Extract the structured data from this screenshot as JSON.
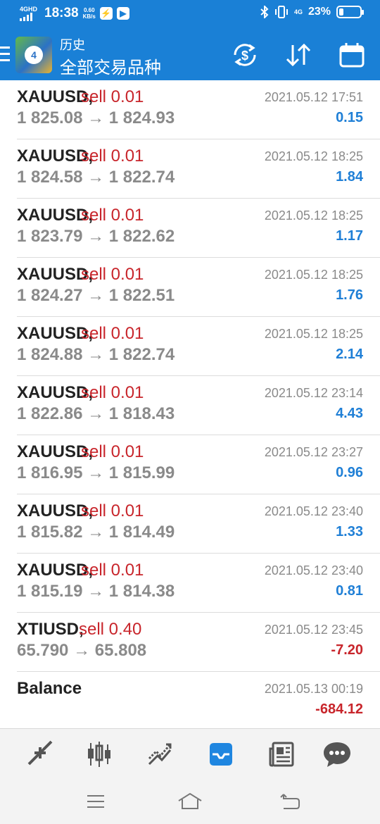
{
  "status_bar": {
    "network": "4GHD",
    "time": "18:38",
    "speed_value": "0.60",
    "speed_unit": "KB/s",
    "right_network": "4G",
    "battery_percent": "23%",
    "battery_level": 0.23,
    "icons": [
      "signal-icon",
      "flash-icon",
      "play-icon",
      "bluetooth-icon",
      "vibrate-icon",
      "battery-icon"
    ]
  },
  "toolbar": {
    "subtitle": "历史",
    "title": "全部交易品种",
    "icons": [
      "currency-exchange-icon",
      "sort-arrows-icon",
      "calendar-icon"
    ]
  },
  "trades": [
    {
      "symbol": "XAUUSD,",
      "side": "sell 0.01",
      "open": "1 825.08",
      "close": "1 824.93",
      "time": "2021.05.12 17:51",
      "profit": "0.15",
      "sign": "pos"
    },
    {
      "symbol": "XAUUSD,",
      "side": "sell 0.01",
      "open": "1 824.58",
      "close": "1 822.74",
      "time": "2021.05.12 18:25",
      "profit": "1.84",
      "sign": "pos"
    },
    {
      "symbol": "XAUUSD,",
      "side": "sell 0.01",
      "open": "1 823.79",
      "close": "1 822.62",
      "time": "2021.05.12 18:25",
      "profit": "1.17",
      "sign": "pos"
    },
    {
      "symbol": "XAUUSD,",
      "side": "sell 0.01",
      "open": "1 824.27",
      "close": "1 822.51",
      "time": "2021.05.12 18:25",
      "profit": "1.76",
      "sign": "pos"
    },
    {
      "symbol": "XAUUSD,",
      "side": "sell 0.01",
      "open": "1 824.88",
      "close": "1 822.74",
      "time": "2021.05.12 18:25",
      "profit": "2.14",
      "sign": "pos"
    },
    {
      "symbol": "XAUUSD,",
      "side": "sell 0.01",
      "open": "1 822.86",
      "close": "1 818.43",
      "time": "2021.05.12 23:14",
      "profit": "4.43",
      "sign": "pos"
    },
    {
      "symbol": "XAUUSD,",
      "side": "sell 0.01",
      "open": "1 816.95",
      "close": "1 815.99",
      "time": "2021.05.12 23:27",
      "profit": "0.96",
      "sign": "pos"
    },
    {
      "symbol": "XAUUSD,",
      "side": "sell 0.01",
      "open": "1 815.82",
      "close": "1 814.49",
      "time": "2021.05.12 23:40",
      "profit": "1.33",
      "sign": "pos"
    },
    {
      "symbol": "XAUUSD,",
      "side": "sell 0.01",
      "open": "1 815.19",
      "close": "1 814.38",
      "time": "2021.05.12 23:40",
      "profit": "0.81",
      "sign": "pos"
    },
    {
      "symbol": "XTIUSD,",
      "side": "sell 0.40",
      "open": "65.790",
      "close": "65.808",
      "time": "2021.05.12 23:45",
      "profit": "-7.20",
      "sign": "neg"
    }
  ],
  "balance": {
    "label": "Balance",
    "time": "2021.05.13 00:19",
    "value": "-684.12"
  },
  "arrow": "→",
  "bottom_nav": [
    {
      "name": "quotes",
      "icon": "quotes-arrows-icon",
      "active": false
    },
    {
      "name": "chart",
      "icon": "candlestick-icon",
      "active": false
    },
    {
      "name": "trade",
      "icon": "trend-icon",
      "active": false
    },
    {
      "name": "history",
      "icon": "inbox-icon",
      "active": true
    },
    {
      "name": "news",
      "icon": "newspaper-icon",
      "active": false
    },
    {
      "name": "messages",
      "icon": "chat-icon",
      "active": false
    }
  ],
  "colors": {
    "primary": "#1a80d6",
    "sell": "#c8252b",
    "profit_positive": "#1f7fd6",
    "profit_negative": "#c8252b",
    "muted": "#8a8a8a",
    "nav_icon": "#555555"
  }
}
